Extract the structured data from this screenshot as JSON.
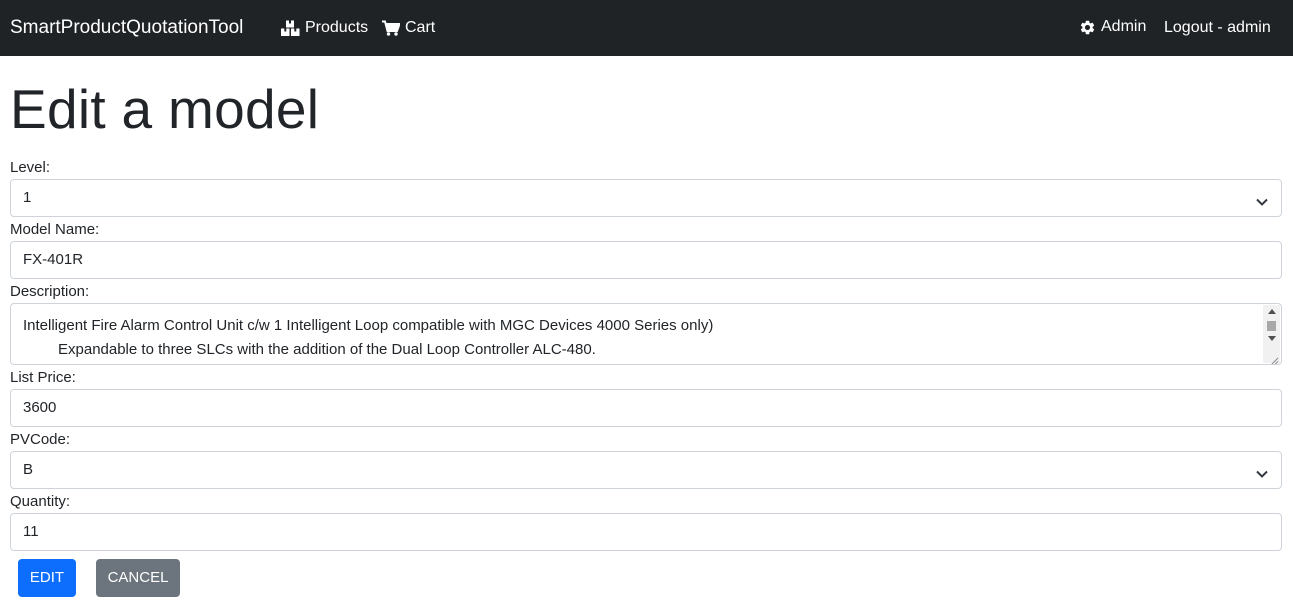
{
  "navbar": {
    "brand": "SmartProductQuotationTool",
    "products": "Products",
    "cart": "Cart",
    "admin": "Admin",
    "logout": "Logout - admin",
    "icons": {
      "products": "boxes-icon",
      "cart": "cart-icon",
      "admin": "gear-icon"
    }
  },
  "page": {
    "title": "Edit a model"
  },
  "form": {
    "level": {
      "label": "Level:",
      "value": "1"
    },
    "model_name": {
      "label": "Model Name:",
      "value": "FX-401R"
    },
    "description": {
      "label": "Description:",
      "line1": "Intelligent Fire Alarm Control Unit c/w 1 Intelligent Loop compatible with MGC Devices 4000 Series only)",
      "line2": "Expandable to three SLCs with the addition of the Dual Loop Controller ALC-480."
    },
    "list_price": {
      "label": "List Price:",
      "value": "3600"
    },
    "pvcode": {
      "label": "PVCode:",
      "value": "B"
    },
    "quantity": {
      "label": "Quantity:",
      "value": "11"
    }
  },
  "buttons": {
    "edit": "EDIT",
    "cancel": "CANCEL"
  },
  "colors": {
    "navbar": "#1f2326",
    "primary": "#0d6efd",
    "secondary": "#6c757d",
    "border": "#ced4da"
  }
}
